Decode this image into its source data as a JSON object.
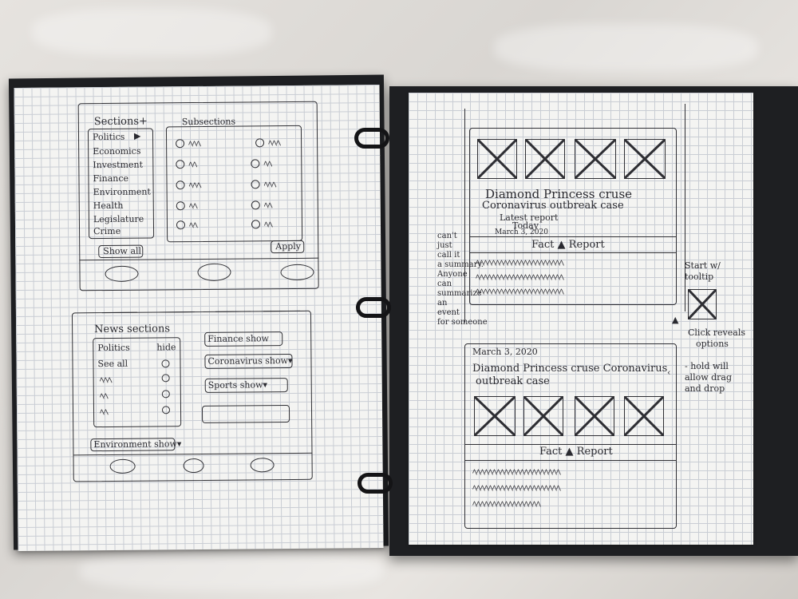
{
  "left_sketch": {
    "sections_label": "Sections+",
    "subsections_label": "Subsections",
    "sections": [
      "Politics",
      "Economics",
      "Investment",
      "Finance",
      "Environment",
      "Health",
      "Legislature",
      "Crime"
    ],
    "show_all_label": "Show all",
    "apply_label": "Apply",
    "news_sections_label": "News sections",
    "politics_label": "Politics",
    "hide_label": "hide",
    "see_all_label": "See all",
    "finance_chip": "Finance show",
    "coronavirus_chip": "Coronavirus show▾",
    "sports_chip": "Sports show▾",
    "environment_chip": "Environment show▾"
  },
  "right_sketch": {
    "card1_title": "Diamond Princess cruse",
    "card1_subtitle": "Coronavirus outbreak case",
    "card1_latest": "Latest report",
    "card1_today": "Today",
    "card1_date": "March 3, 2020",
    "fact_report_label": "Fact ▲ Report",
    "side_note_lines": [
      "can't",
      "just",
      "call it",
      "a summary.",
      "Anyone",
      "can",
      "summarize",
      "an",
      "event",
      "for someone"
    ],
    "start_tooltip_line1": "Start w/",
    "start_tooltip_line2": "tooltip",
    "click_reveals_line1": "Click reveals",
    "click_reveals_line2": "options",
    "card2_date": "March 3, 2020",
    "card2_title": "Diamond Princess cruse Coronavirus",
    "card2_subtitle": "outbreak case",
    "hold_note_lines": [
      "- hold will",
      "allow drag",
      "and drop"
    ],
    "fact_report_label_2": "Fact ▲ Report"
  }
}
